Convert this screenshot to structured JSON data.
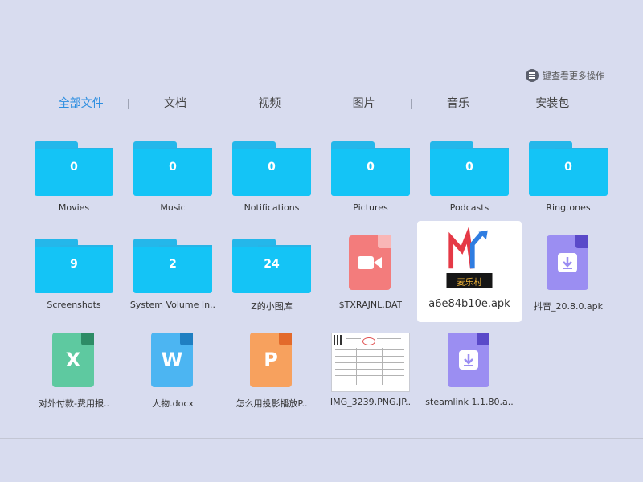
{
  "hint": {
    "text": "键查看更多操作",
    "icon": "menu-icon"
  },
  "tabs": [
    {
      "label": "全部文件",
      "active": true
    },
    {
      "label": "文档",
      "active": false
    },
    {
      "label": "视频",
      "active": false
    },
    {
      "label": "图片",
      "active": false
    },
    {
      "label": "音乐",
      "active": false
    },
    {
      "label": "安装包",
      "active": false
    }
  ],
  "items": [
    {
      "type": "folder",
      "label": "Movies",
      "count": "0"
    },
    {
      "type": "folder",
      "label": "Music",
      "count": "0"
    },
    {
      "type": "folder",
      "label": "Notifications",
      "count": "0"
    },
    {
      "type": "folder",
      "label": "Pictures",
      "count": "0"
    },
    {
      "type": "folder",
      "label": "Podcasts",
      "count": "0"
    },
    {
      "type": "folder",
      "label": "Ringtones",
      "count": "0"
    },
    {
      "type": "folder",
      "label": "Screenshots",
      "count": "9"
    },
    {
      "type": "folder",
      "label": "System Volume In..",
      "count": "2"
    },
    {
      "type": "folder",
      "label": "Z的小图库",
      "count": "24"
    },
    {
      "type": "video",
      "label": "$TXRAJNL.DAT",
      "icon": "video-file-icon"
    },
    {
      "type": "app",
      "label": "a6e84b10e.apk",
      "icon": "app-logo-icon",
      "selected": true,
      "logo_text": "麦乐村"
    },
    {
      "type": "apk",
      "label": "抖音_20.8.0.apk",
      "icon": "apk-file-icon"
    },
    {
      "type": "xls",
      "label": "对外付款-费用报..",
      "glyph": "X",
      "icon": "excel-file-icon"
    },
    {
      "type": "doc",
      "label": "人物.docx",
      "glyph": "W",
      "icon": "word-file-icon"
    },
    {
      "type": "ppt",
      "label": "怎么用投影播放P..",
      "glyph": "P",
      "icon": "ppt-file-icon"
    },
    {
      "type": "image",
      "label": "IMG_3239.PNG.JP..",
      "icon": "image-thumbnail"
    },
    {
      "type": "apk",
      "label": "steamlink 1.1.80.a..",
      "icon": "apk-file-icon"
    }
  ],
  "colors": {
    "folder": "#14c4f6",
    "video": "#f37c7c",
    "apk": "#9b8ef2",
    "xls": "#5ec9a0",
    "doc": "#4cb5f2",
    "ppt": "#f7a15e",
    "accent": "#2d8ee0"
  }
}
